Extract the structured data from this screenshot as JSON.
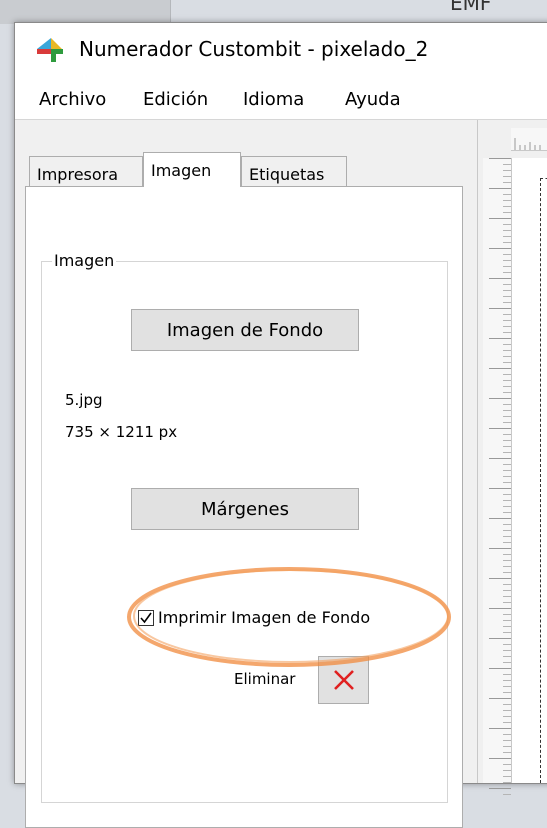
{
  "background": {
    "fragment_text": "EMF"
  },
  "window": {
    "title": "Numerador Custombit - pixelado_2"
  },
  "menu": [
    "Archivo",
    "Edición",
    "Idioma",
    "Ayuda"
  ],
  "tabs": [
    "Impresora",
    "Imagen",
    "Etiquetas"
  ],
  "active_tab": "Imagen",
  "image_group": {
    "label": "Imagen",
    "background_button": "Imagen de Fondo",
    "file_name": "5.jpg",
    "dimensions": "735 × 1211 px",
    "margins_button": "Márgenes",
    "print_checkbox_label": "Imprimir Imagen de Fondo",
    "print_checked": true,
    "delete_label": "Eliminar"
  },
  "colors": {
    "highlight": "#f08a3c",
    "delete_x": "#e02020",
    "icon_green": "#2e9b3e",
    "icon_red": "#d93a3a",
    "icon_yellow": "#e9b824"
  },
  "icons": {
    "app": "app-logo-icon",
    "delete": "close-x-icon",
    "check": "checkmark-icon"
  }
}
